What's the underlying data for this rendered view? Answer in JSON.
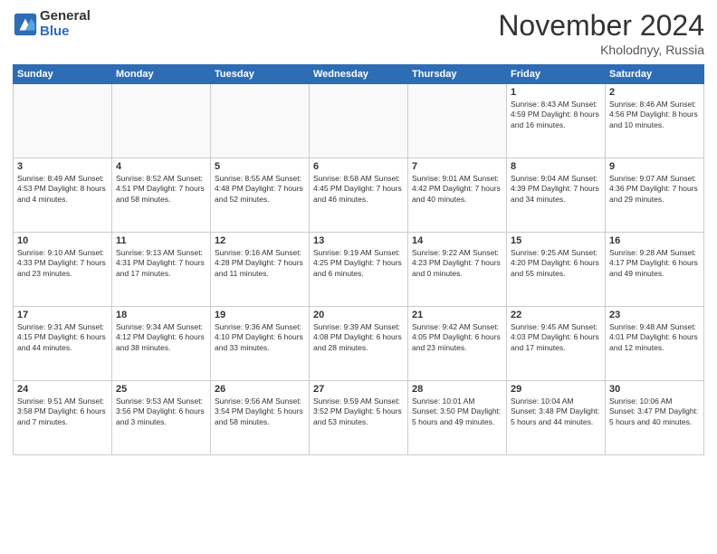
{
  "header": {
    "logo_general": "General",
    "logo_blue": "Blue",
    "month_title": "November 2024",
    "location": "Kholodnyy, Russia"
  },
  "weekdays": [
    "Sunday",
    "Monday",
    "Tuesday",
    "Wednesday",
    "Thursday",
    "Friday",
    "Saturday"
  ],
  "weeks": [
    [
      {
        "day": "",
        "info": ""
      },
      {
        "day": "",
        "info": ""
      },
      {
        "day": "",
        "info": ""
      },
      {
        "day": "",
        "info": ""
      },
      {
        "day": "",
        "info": ""
      },
      {
        "day": "1",
        "info": "Sunrise: 8:43 AM\nSunset: 4:59 PM\nDaylight: 8 hours\nand 16 minutes."
      },
      {
        "day": "2",
        "info": "Sunrise: 8:46 AM\nSunset: 4:56 PM\nDaylight: 8 hours\nand 10 minutes."
      }
    ],
    [
      {
        "day": "3",
        "info": "Sunrise: 8:49 AM\nSunset: 4:53 PM\nDaylight: 8 hours\nand 4 minutes."
      },
      {
        "day": "4",
        "info": "Sunrise: 8:52 AM\nSunset: 4:51 PM\nDaylight: 7 hours\nand 58 minutes."
      },
      {
        "day": "5",
        "info": "Sunrise: 8:55 AM\nSunset: 4:48 PM\nDaylight: 7 hours\nand 52 minutes."
      },
      {
        "day": "6",
        "info": "Sunrise: 8:58 AM\nSunset: 4:45 PM\nDaylight: 7 hours\nand 46 minutes."
      },
      {
        "day": "7",
        "info": "Sunrise: 9:01 AM\nSunset: 4:42 PM\nDaylight: 7 hours\nand 40 minutes."
      },
      {
        "day": "8",
        "info": "Sunrise: 9:04 AM\nSunset: 4:39 PM\nDaylight: 7 hours\nand 34 minutes."
      },
      {
        "day": "9",
        "info": "Sunrise: 9:07 AM\nSunset: 4:36 PM\nDaylight: 7 hours\nand 29 minutes."
      }
    ],
    [
      {
        "day": "10",
        "info": "Sunrise: 9:10 AM\nSunset: 4:33 PM\nDaylight: 7 hours\nand 23 minutes."
      },
      {
        "day": "11",
        "info": "Sunrise: 9:13 AM\nSunset: 4:31 PM\nDaylight: 7 hours\nand 17 minutes."
      },
      {
        "day": "12",
        "info": "Sunrise: 9:16 AM\nSunset: 4:28 PM\nDaylight: 7 hours\nand 11 minutes."
      },
      {
        "day": "13",
        "info": "Sunrise: 9:19 AM\nSunset: 4:25 PM\nDaylight: 7 hours\nand 6 minutes."
      },
      {
        "day": "14",
        "info": "Sunrise: 9:22 AM\nSunset: 4:23 PM\nDaylight: 7 hours\nand 0 minutes."
      },
      {
        "day": "15",
        "info": "Sunrise: 9:25 AM\nSunset: 4:20 PM\nDaylight: 6 hours\nand 55 minutes."
      },
      {
        "day": "16",
        "info": "Sunrise: 9:28 AM\nSunset: 4:17 PM\nDaylight: 6 hours\nand 49 minutes."
      }
    ],
    [
      {
        "day": "17",
        "info": "Sunrise: 9:31 AM\nSunset: 4:15 PM\nDaylight: 6 hours\nand 44 minutes."
      },
      {
        "day": "18",
        "info": "Sunrise: 9:34 AM\nSunset: 4:12 PM\nDaylight: 6 hours\nand 38 minutes."
      },
      {
        "day": "19",
        "info": "Sunrise: 9:36 AM\nSunset: 4:10 PM\nDaylight: 6 hours\nand 33 minutes."
      },
      {
        "day": "20",
        "info": "Sunrise: 9:39 AM\nSunset: 4:08 PM\nDaylight: 6 hours\nand 28 minutes."
      },
      {
        "day": "21",
        "info": "Sunrise: 9:42 AM\nSunset: 4:05 PM\nDaylight: 6 hours\nand 23 minutes."
      },
      {
        "day": "22",
        "info": "Sunrise: 9:45 AM\nSunset: 4:03 PM\nDaylight: 6 hours\nand 17 minutes."
      },
      {
        "day": "23",
        "info": "Sunrise: 9:48 AM\nSunset: 4:01 PM\nDaylight: 6 hours\nand 12 minutes."
      }
    ],
    [
      {
        "day": "24",
        "info": "Sunrise: 9:51 AM\nSunset: 3:58 PM\nDaylight: 6 hours\nand 7 minutes."
      },
      {
        "day": "25",
        "info": "Sunrise: 9:53 AM\nSunset: 3:56 PM\nDaylight: 6 hours\nand 3 minutes."
      },
      {
        "day": "26",
        "info": "Sunrise: 9:56 AM\nSunset: 3:54 PM\nDaylight: 5 hours\nand 58 minutes."
      },
      {
        "day": "27",
        "info": "Sunrise: 9:59 AM\nSunset: 3:52 PM\nDaylight: 5 hours\nand 53 minutes."
      },
      {
        "day": "28",
        "info": "Sunrise: 10:01 AM\nSunset: 3:50 PM\nDaylight: 5 hours\nand 49 minutes."
      },
      {
        "day": "29",
        "info": "Sunrise: 10:04 AM\nSunset: 3:48 PM\nDaylight: 5 hours\nand 44 minutes."
      },
      {
        "day": "30",
        "info": "Sunrise: 10:06 AM\nSunset: 3:47 PM\nDaylight: 5 hours\nand 40 minutes."
      }
    ]
  ]
}
